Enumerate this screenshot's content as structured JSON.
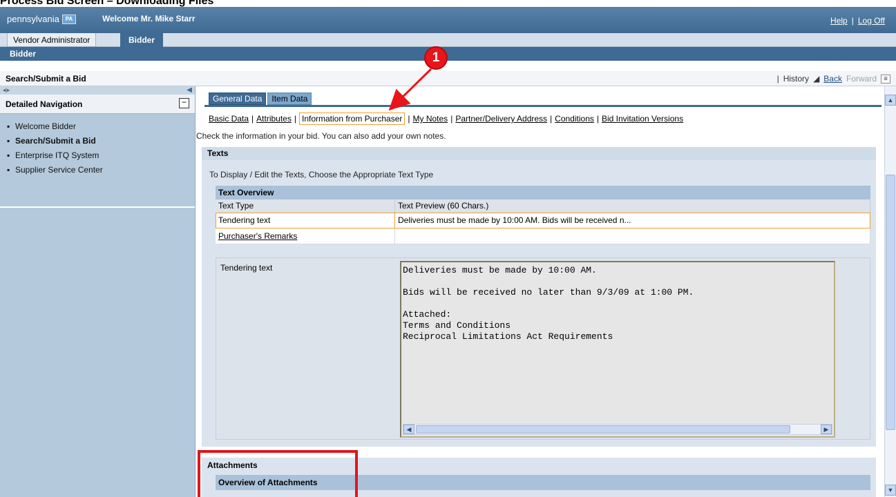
{
  "doc_title": "Process Bid Screen – Downloading Files",
  "header": {
    "brand_text": "pennsylvania",
    "brand_logo_text": "PA",
    "welcome": "Welcome Mr. Mike Starr",
    "help_label": "Help",
    "separator": "|",
    "logoff_label": "Log Off"
  },
  "roles": {
    "vendor_label": "Vendor Administrator",
    "bidder_label": "Bidder"
  },
  "subnav": {
    "label": "Bidder"
  },
  "path": {
    "crumb": "Search/Submit a Bid",
    "sep": "|",
    "history_label": "History",
    "back_label": "Back",
    "forward_label": "Forward"
  },
  "leftnav": {
    "title": "Detailed Navigation",
    "collapse_symbol": "−",
    "items": [
      {
        "label": "Welcome Bidder",
        "active": false
      },
      {
        "label": "Search/Submit a Bid",
        "active": true
      },
      {
        "label": "Enterprise ITQ System",
        "active": false
      },
      {
        "label": "Supplier Service Center",
        "active": false
      }
    ]
  },
  "tabs": {
    "general": "General Data",
    "item": "Item Data"
  },
  "sublinks": {
    "basic": "Basic Data",
    "attributes": "Attributes",
    "purchaser": "Information from Purchaser",
    "notes": "My Notes",
    "partner": "Partner/Delivery Address",
    "conditions": "Conditions",
    "versions": "Bid Invitation Versions",
    "sep": "|"
  },
  "hint": "Check the information in your bid. You can also add your own notes.",
  "texts": {
    "title": "Texts",
    "instruction": "To Display / Edit the Texts, Choose the Appropriate Text Type",
    "overview_title": "Text Overview",
    "col_type": "Text Type",
    "col_preview": "Text Preview (60 Chars.)",
    "rows": [
      {
        "type": "Tendering text",
        "preview": "Deliveries must be made by 10:00 AM. Bids will be received n..."
      },
      {
        "type": "Purchaser's Remarks",
        "preview": ""
      }
    ],
    "editor_label": "Tendering text",
    "editor_content": "Deliveries must be made by 10:00 AM.\n\nBids will be received no later than 9/3/09 at 1:00 PM.\n\nAttached:\nTerms and Conditions\nReciprocal Limitations Act Requirements"
  },
  "attachments": {
    "title": "Attachments",
    "overview_title": "Overview of Attachments"
  },
  "annotation": {
    "callout_number": "1",
    "callout_color": "#e8161b"
  },
  "colors": {
    "header_blue": "#3e6a93",
    "nav_blue": "#b5c9dc",
    "highlight_orange": "#f0a030"
  }
}
